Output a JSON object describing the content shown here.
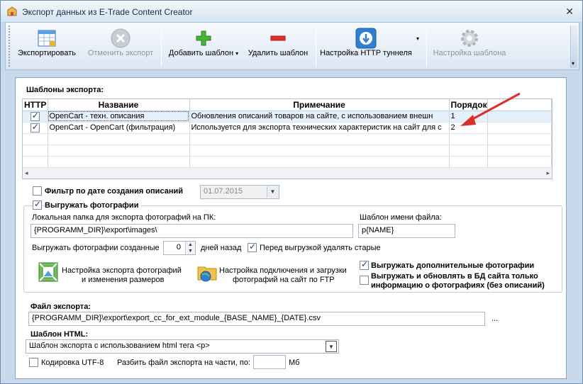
{
  "window": {
    "title": "Экспорт данных из E-Trade Content Creator"
  },
  "toolbar": {
    "export": "Экспортировать",
    "cancel_export": "Отменить экспорт",
    "add_template": "Добавить шаблон",
    "delete_template": "Удалить шаблон",
    "http_tunnel": "Настройка HTTP туннеля",
    "template_settings": "Настройка шаблона"
  },
  "templates": {
    "label": "Шаблоны экспорта:",
    "columns": [
      "HTTP",
      "Название",
      "Примечание",
      "Порядок"
    ],
    "rows": [
      {
        "http": true,
        "name": "OpenCart - техн. описания",
        "note": "Обновления описаний товаров на сайте, с использованием внешн",
        "order": "1"
      },
      {
        "http": true,
        "name": "OpenCart - OpenCart (фильтрация)",
        "note": "Используется для экспорта технических характеристик на сайт для с",
        "order": "2"
      }
    ]
  },
  "date_filter": {
    "label": "Фильтр по дате создания описаний",
    "checked": false,
    "value": "01.07.2015"
  },
  "photos": {
    "label": "Выгружать фотографии",
    "checked": true,
    "folder_label": "Локальная папка для экспорта фотографий на ПК:",
    "folder_value": "{PROGRAMM_DIR}\\export\\images\\",
    "filename_label": "Шаблон имени файла:",
    "filename_value": "p{NAME}",
    "created_label": "Выгружать фотографии созданные",
    "created_days": "0",
    "days_ago": "дней назад",
    "delete_old_label": "Перед выгрузкой удалять старые",
    "delete_old_checked": true,
    "resize_settings_line1": "Настройка экспорта фотографий",
    "resize_settings_line2": "и изменения размеров",
    "ftp_settings_line1": "Настройка подключения и загрузки",
    "ftp_settings_line2": "фотографий на сайт по FTP",
    "extra_photos_label": "Выгружать дополнительные фотографии",
    "extra_photos_checked": true,
    "update_db_line1": "Выгружать и обновлять в БД сайта только",
    "update_db_line2": "информацию о фотографиях (без описаний)",
    "update_db_checked": false
  },
  "export_file": {
    "label": "Файл экспорта:",
    "value": "{PROGRAMM_DIR}\\export\\export_cc_for_ext_module_{BASE_NAME}_{DATE}.csv",
    "browse": "..."
  },
  "html_template": {
    "label": "Шаблон HTML:",
    "value": "Шаблон экспорта с использованием html тега <p>"
  },
  "utf8": {
    "label": "Кодировка UTF-8",
    "checked": false
  },
  "split": {
    "label": "Разбить файл экспорта на части, по:",
    "value": "",
    "unit": "Мб"
  }
}
